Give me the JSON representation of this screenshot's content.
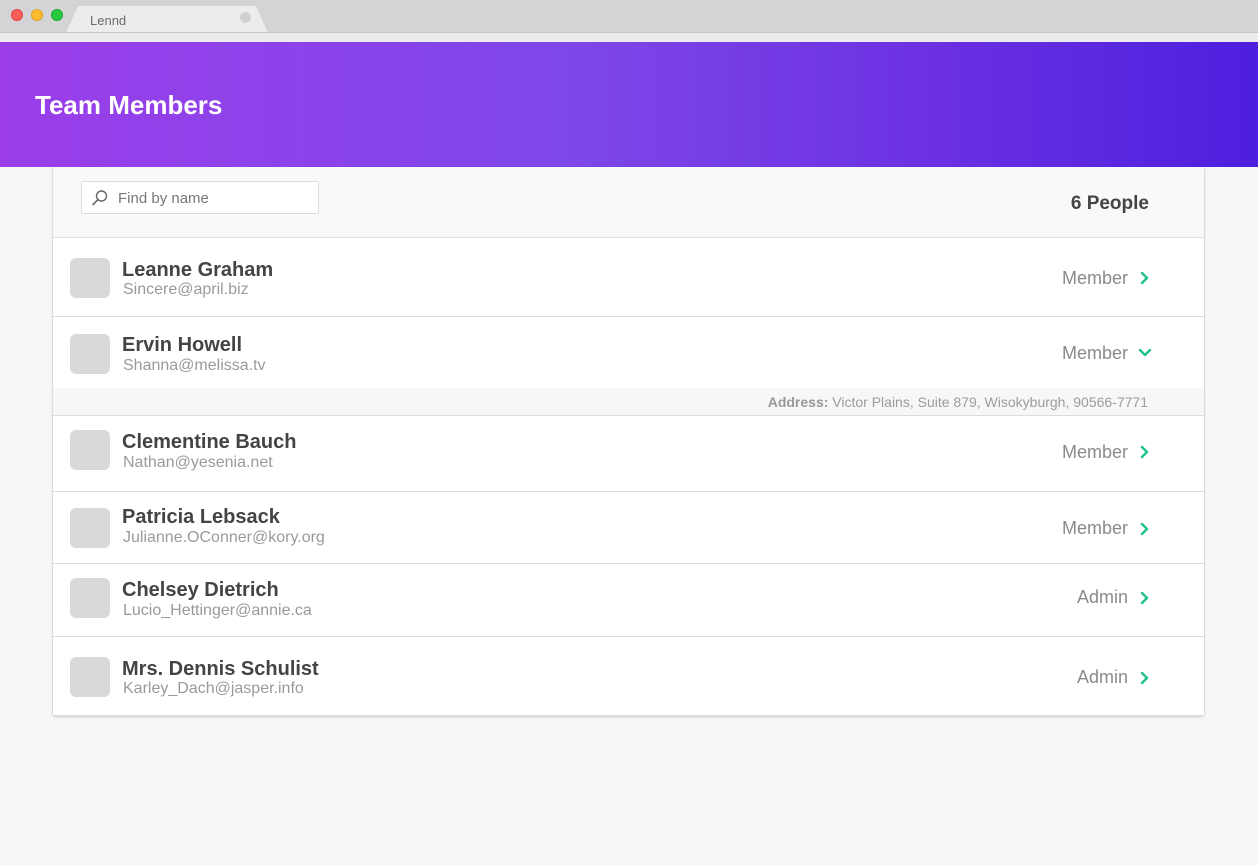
{
  "browser": {
    "tab_title": "Lennd"
  },
  "header": {
    "title": "Team Members"
  },
  "toolbar": {
    "search_placeholder": "Find by name",
    "search_value": "",
    "count_label": "6 People"
  },
  "members": [
    {
      "name": "Leanne Graham",
      "email": "Sincere@april.biz",
      "role": "Member",
      "expanded": false
    },
    {
      "name": "Ervin Howell",
      "email": "Shanna@melissa.tv",
      "role": "Member",
      "expanded": true,
      "address_label": "Address:",
      "address": "Victor Plains, Suite 879, Wisokyburgh, 90566-7771"
    },
    {
      "name": "Clementine Bauch",
      "email": "Nathan@yesenia.net",
      "role": "Member",
      "expanded": false
    },
    {
      "name": "Patricia Lebsack",
      "email": "Julianne.OConner@kory.org",
      "role": "Member",
      "expanded": false
    },
    {
      "name": "Chelsey Dietrich",
      "email": "Lucio_Hettinger@annie.ca",
      "role": "Admin",
      "expanded": false
    },
    {
      "name": "Mrs. Dennis Schulist",
      "email": "Karley_Dach@jasper.info",
      "role": "Admin",
      "expanded": false
    }
  ],
  "colors": {
    "accent_green": "#1ec28b",
    "header_gradient_start": "#9b3eea",
    "header_gradient_end": "#4d1fde",
    "avatar_placeholder": "#d9d9d9"
  },
  "icons": {
    "search": "search-icon",
    "collapsed": "chevron-right-icon",
    "expanded": "chevron-down-icon"
  }
}
